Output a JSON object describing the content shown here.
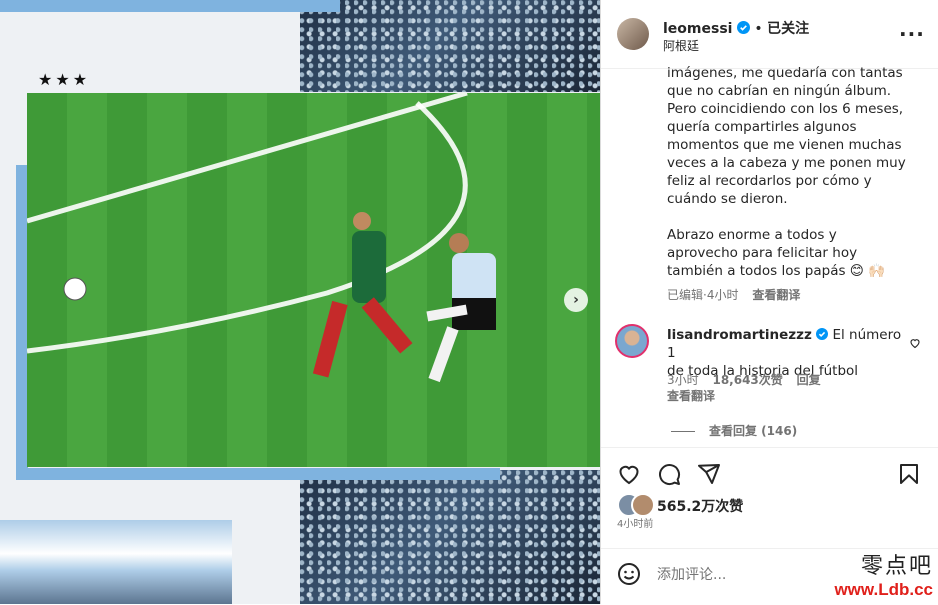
{
  "post": {
    "username": "leomessi",
    "follow_status": "已关注",
    "location": "阿根廷",
    "caption_lines": [
      "imágenes, me quedaría con tantas",
      "que no cabrían en ningún álbum.",
      "Pero coincidiendo con los 6 meses,",
      "quería compartirles algunos",
      "momentos que me vienen muchas",
      "veces a la cabeza y me ponen muy",
      "feliz al recordarlos por cómo y",
      "cuándo se dieron."
    ],
    "caption_lines2": [
      "Abrazo enorme a todos y",
      "aprovecho para felicitar hoy",
      "también a todos los papás 😊 🙌🏻"
    ],
    "edited": "已编辑",
    "time": "4小时",
    "see_translation": "查看翻译",
    "likes": "565.2万次赞",
    "posted_ago": "4小时前",
    "media_stars": "★★★"
  },
  "comment": {
    "username": "lisandromartinezzz",
    "text_line1": "El número 1",
    "text_line2": "de toda la historia del fútbol",
    "time": "3小时",
    "likes": "18,643次赞",
    "reply": "回复",
    "see_translation": "查看翻译",
    "view_replies": "查看回复 (146)"
  },
  "add_comment": {
    "placeholder": "添加评论..."
  },
  "watermark": {
    "line1": "零点吧",
    "line2": "www.Ldb.cc"
  },
  "colors": {
    "verified": "#0095f6",
    "watermark_red": "#e0201b",
    "sky_blue": "#7fb3df"
  }
}
